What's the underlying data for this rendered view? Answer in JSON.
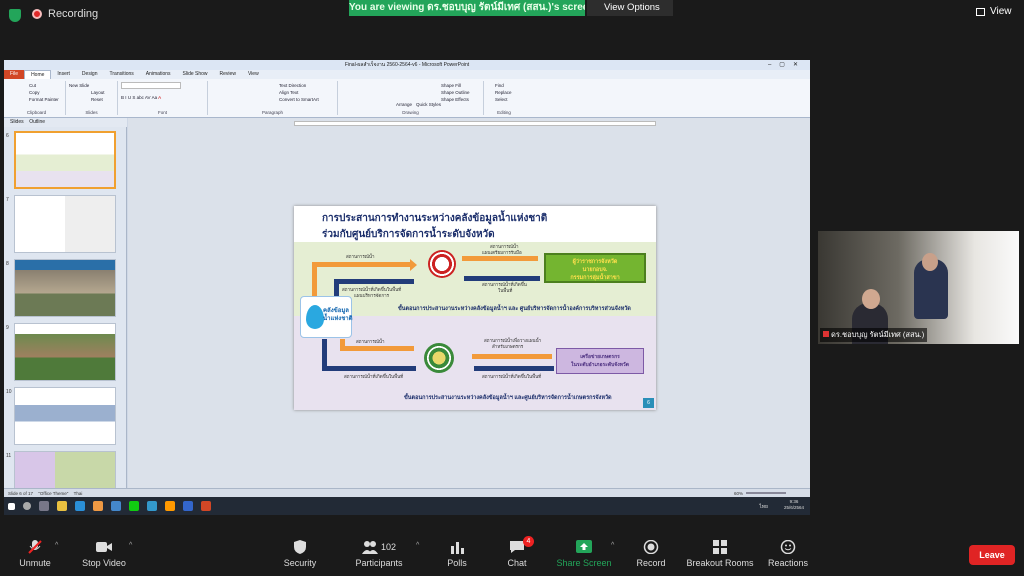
{
  "zoom_top": {
    "recording_label": "Recording",
    "viewing_banner": "You are viewing ดร.ชอบบุญ รัตน์มีเทศ (สสน.)'s screen",
    "view_options": "View Options",
    "view_button": "View"
  },
  "ppt": {
    "window_title": "Final-ผลสำเร็จงาน 2560-2564-v6 - Microsoft PowerPoint",
    "menu": [
      "File",
      "Home",
      "Insert",
      "Design",
      "Transitions",
      "Animations",
      "Slide Show",
      "Review",
      "View"
    ],
    "ribbon_groups": [
      {
        "label": "Clipboard",
        "items": [
          "Cut",
          "Copy",
          "Format Painter"
        ]
      },
      {
        "label": "Slides",
        "items": [
          "New Slide",
          "Layout",
          "Reset",
          "Section"
        ]
      },
      {
        "label": "Font",
        "items": [
          "B",
          "I",
          "U",
          "S",
          "abc",
          "AV",
          "Aa",
          "A"
        ]
      },
      {
        "label": "Paragraph",
        "items": [
          "Text Direction",
          "Align Text",
          "Convert to SmartArt"
        ]
      },
      {
        "label": "Drawing",
        "items": [
          "Arrange",
          "Quick Styles",
          "Shape Fill",
          "Shape Outline",
          "Shape Effects"
        ]
      },
      {
        "label": "Editing",
        "items": [
          "Find",
          "Replace",
          "Select"
        ]
      }
    ],
    "panel_tabs": [
      "Slides",
      "Outline"
    ],
    "thumb_numbers": [
      "6",
      "7",
      "8",
      "9",
      "10",
      "11"
    ],
    "slide": {
      "title_line1": "การประสานการทำงานระหว่างคลังข้อมูลน้ำแห่งชาติ",
      "title_line2": "ร่วมกับศูนย์บริการจัดการน้ำระดับจังหวัด",
      "logo_text_1": "คลังข้อมูล",
      "logo_text_2": "น้ำแห่งชาติ",
      "green_box": [
        "ผู้ว่าราชการจังหวัด",
        "นายกอบจ.",
        "กรรมการลุ่มน้ำสาขา"
      ],
      "purple_box": [
        "เครือข่ายเกษตรกร",
        "ในระดับอำเภอระดับจังหวัด"
      ],
      "labels": {
        "a1": "สถานการณ์น้ำ",
        "a2": "สถานการณ์น้ำที่เกิดขึ้นในพื้นที่",
        "a3": "แผนบริหารจัดการ",
        "a4": "สถานการณ์น้ำ",
        "a5": "แผนเตรียมการรับมือ",
        "a6": "สถานการณ์น้ำที่เกิดขึ้น",
        "a7": "ในพื้นที่",
        "b1": "สถานการณ์น้ำ",
        "b2": "สถานการณ์น้ำที่เกิดขึ้นในพื้นที่",
        "b3": "สถานการณ์น้ำเพื่อวางแผนน้ำ",
        "b4": "สำหรับเกษตรกร",
        "b5": "สถานการณ์น้ำที่เกิดขึ้นในพื้นที่"
      },
      "caption1": "ขั้นตอนการประสานงานระหว่างคลังข้อมูลน้ำฯ และ ศูนย์บริหารจัดการน้ำองค์การบริหารส่วนจังหวัด",
      "caption2": "ขั้นตอนการประสานงานระหว่างคลังข้อมูลน้ำฯ และศูนย์บริหารจัดการน้ำเกษตรกรจังหวัด",
      "page_number": "6"
    },
    "status": {
      "slide_info": "Slide 6 of 17",
      "theme": "\"Office Theme\"",
      "language": "Thai",
      "zoom": "60%"
    },
    "taskbar_time": "9:36",
    "taskbar_date": "25/6/2564",
    "taskbar_lang": "ไทย"
  },
  "video_name": "ดร.ชอบบุญ รัตน์มีเทศ (สสน.)",
  "toolbar": {
    "unmute": "Unmute",
    "stop_video": "Stop Video",
    "security": "Security",
    "participants": "Participants",
    "participants_count": "102",
    "polls": "Polls",
    "chat": "Chat",
    "chat_badge": "4",
    "share_screen": "Share Screen",
    "record": "Record",
    "breakout": "Breakout Rooms",
    "reactions": "Reactions",
    "leave": "Leave"
  },
  "colors": {
    "zoom_green": "#23a55a",
    "leave_red": "#e02424",
    "ppt_file_tab": "#d24726",
    "slide_title": "#1b2e6b"
  }
}
